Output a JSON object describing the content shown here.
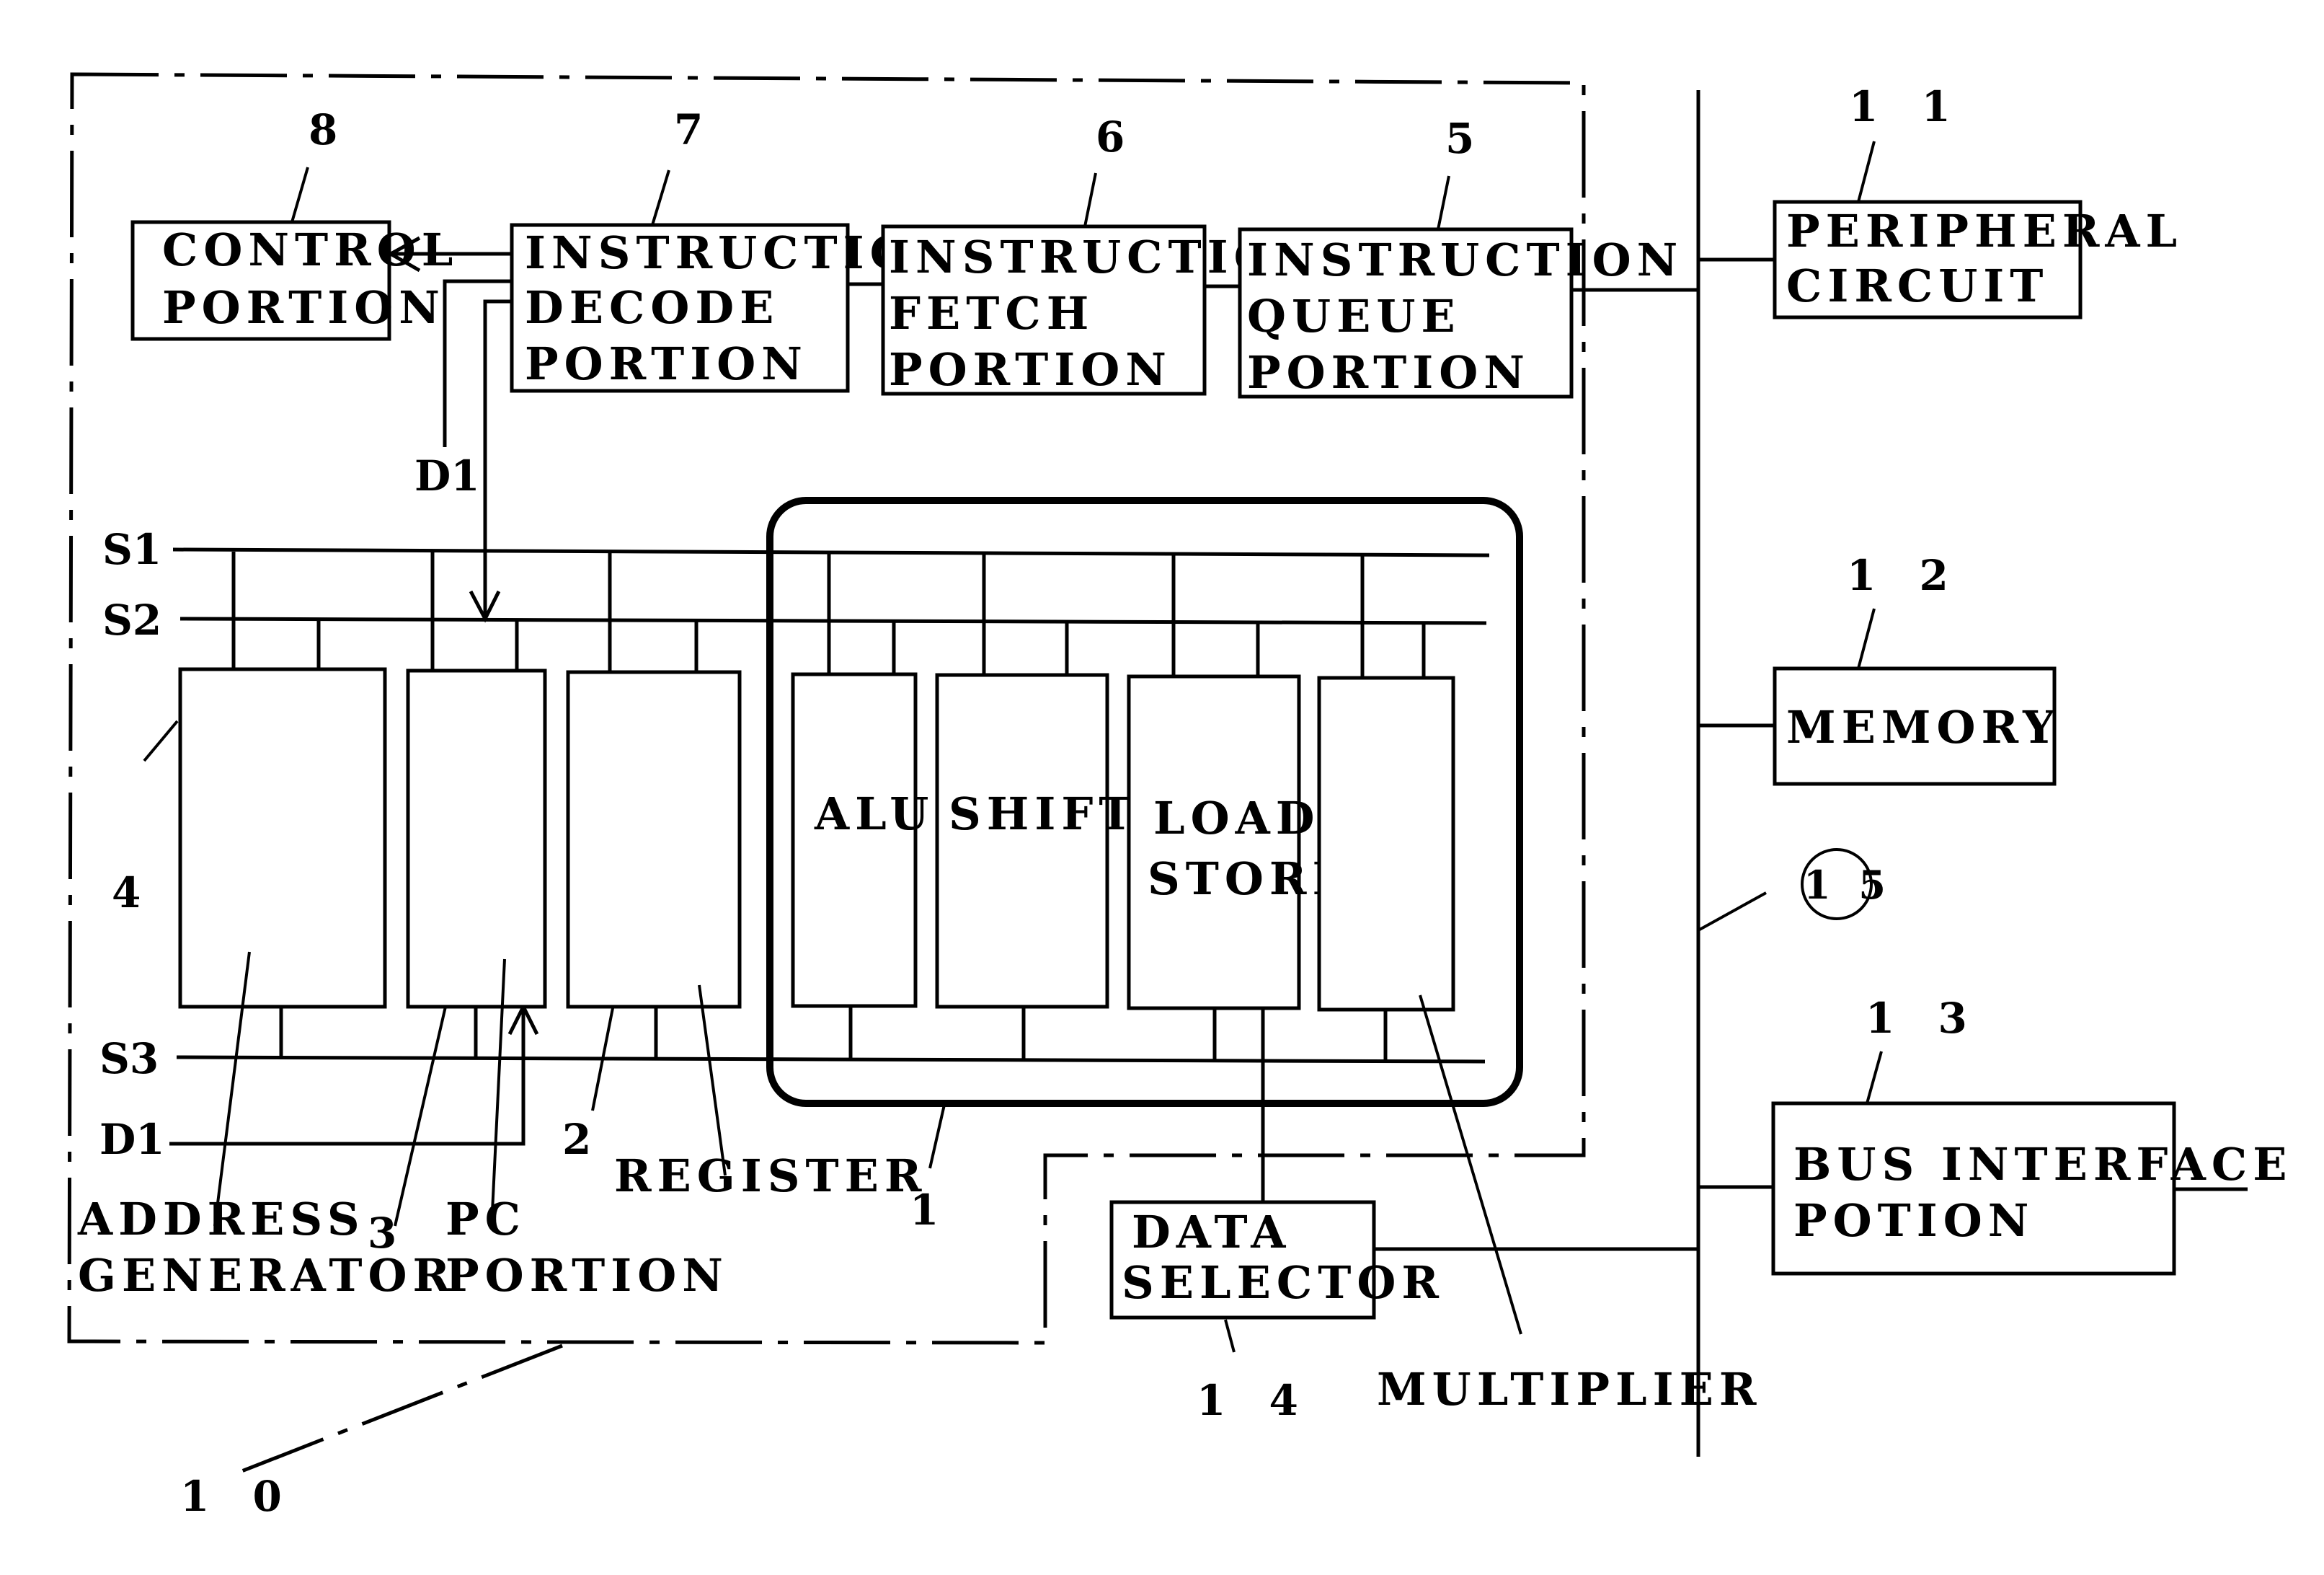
{
  "figure": {
    "container_ref": "1 0",
    "blocks": {
      "control": {
        "ref": "8",
        "lines": [
          "CONTROL",
          "PORTION"
        ]
      },
      "decode": {
        "ref": "7",
        "lines": [
          "INSTRUCTION",
          "DECODE",
          "PORTION"
        ]
      },
      "fetch": {
        "ref": "6",
        "lines": [
          "INSTRUCTION",
          "FETCH",
          "PORTION"
        ]
      },
      "queue": {
        "ref": "5",
        "lines": [
          "INSTRUCTION",
          "QUEUE",
          "PORTION"
        ]
      },
      "peripheral": {
        "ref": "1 1",
        "lines": [
          "PERIPHERAL",
          "CIRCUIT"
        ]
      },
      "memory": {
        "ref": "1 2",
        "lines": [
          "MEMORY"
        ]
      },
      "bus_interface": {
        "ref": "1 3",
        "lines": [
          "BUS INTERFACE",
          "POTION"
        ]
      },
      "data_selector": {
        "ref": "1 4",
        "lines": [
          "DATA",
          "SELECTOR"
        ]
      },
      "alu": {
        "lines": [
          "ALU"
        ]
      },
      "shift": {
        "lines": [
          "SHIFT"
        ]
      },
      "load_store": {
        "lines": [
          "LOAD",
          "STORE"
        ]
      }
    },
    "bus_ref": "1 5",
    "signals": {
      "s1": "S1",
      "s2": "S2",
      "s3": "S3",
      "d1_top": "D1",
      "d1_bottom": "D1"
    },
    "callouts": {
      "address_generator_ref": "4",
      "address_generator": [
        "ADDRESS",
        "GENERATOR"
      ],
      "pc_ref": "3",
      "pc": [
        "PC",
        "PORTION"
      ],
      "register_ref": "2",
      "register": "REGISTER",
      "execution_unit_ref": "1",
      "multiplier": "MULTIPLIER"
    }
  }
}
